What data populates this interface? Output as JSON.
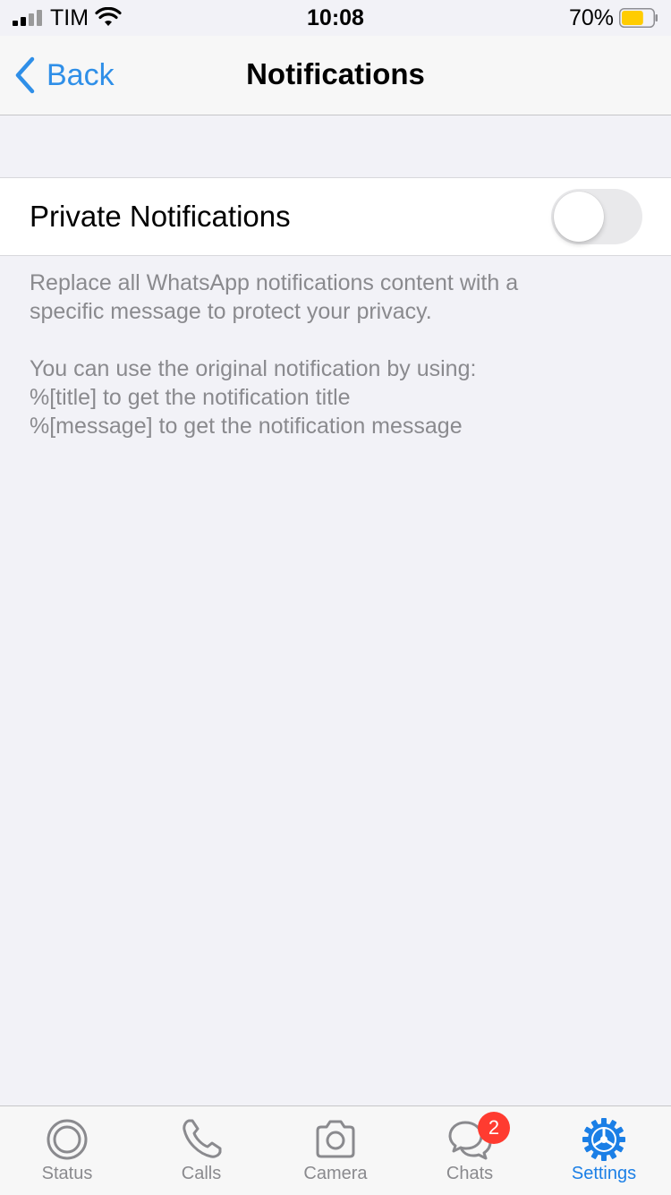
{
  "status_bar": {
    "carrier": "TIM",
    "time": "10:08",
    "battery_percent": "70%",
    "battery_level": 0.7,
    "battery_color": "#ffcc00"
  },
  "nav": {
    "back_label": "Back",
    "title": "Notifications",
    "accent_color": "#2f8fe8"
  },
  "settings": {
    "private_notifications": {
      "label": "Private Notifications",
      "enabled": false
    }
  },
  "footer": {
    "line1": "Replace all WhatsApp notifications content with a",
    "line2": "specific message to protect your privacy.",
    "line3": "You can use the original notification by using:",
    "line4": "%[title] to get the notification title",
    "line5": "%[message] to get the notification message"
  },
  "tab_bar": {
    "tabs": [
      {
        "label": "Status",
        "icon": "status-icon",
        "active": false
      },
      {
        "label": "Calls",
        "icon": "phone-icon",
        "active": false
      },
      {
        "label": "Camera",
        "icon": "camera-icon",
        "active": false
      },
      {
        "label": "Chats",
        "icon": "chats-icon",
        "active": false,
        "badge": "2"
      },
      {
        "label": "Settings",
        "icon": "gear-icon",
        "active": true
      }
    ],
    "active_color": "#1b7fe6",
    "inactive_color": "#8a8a8e"
  }
}
